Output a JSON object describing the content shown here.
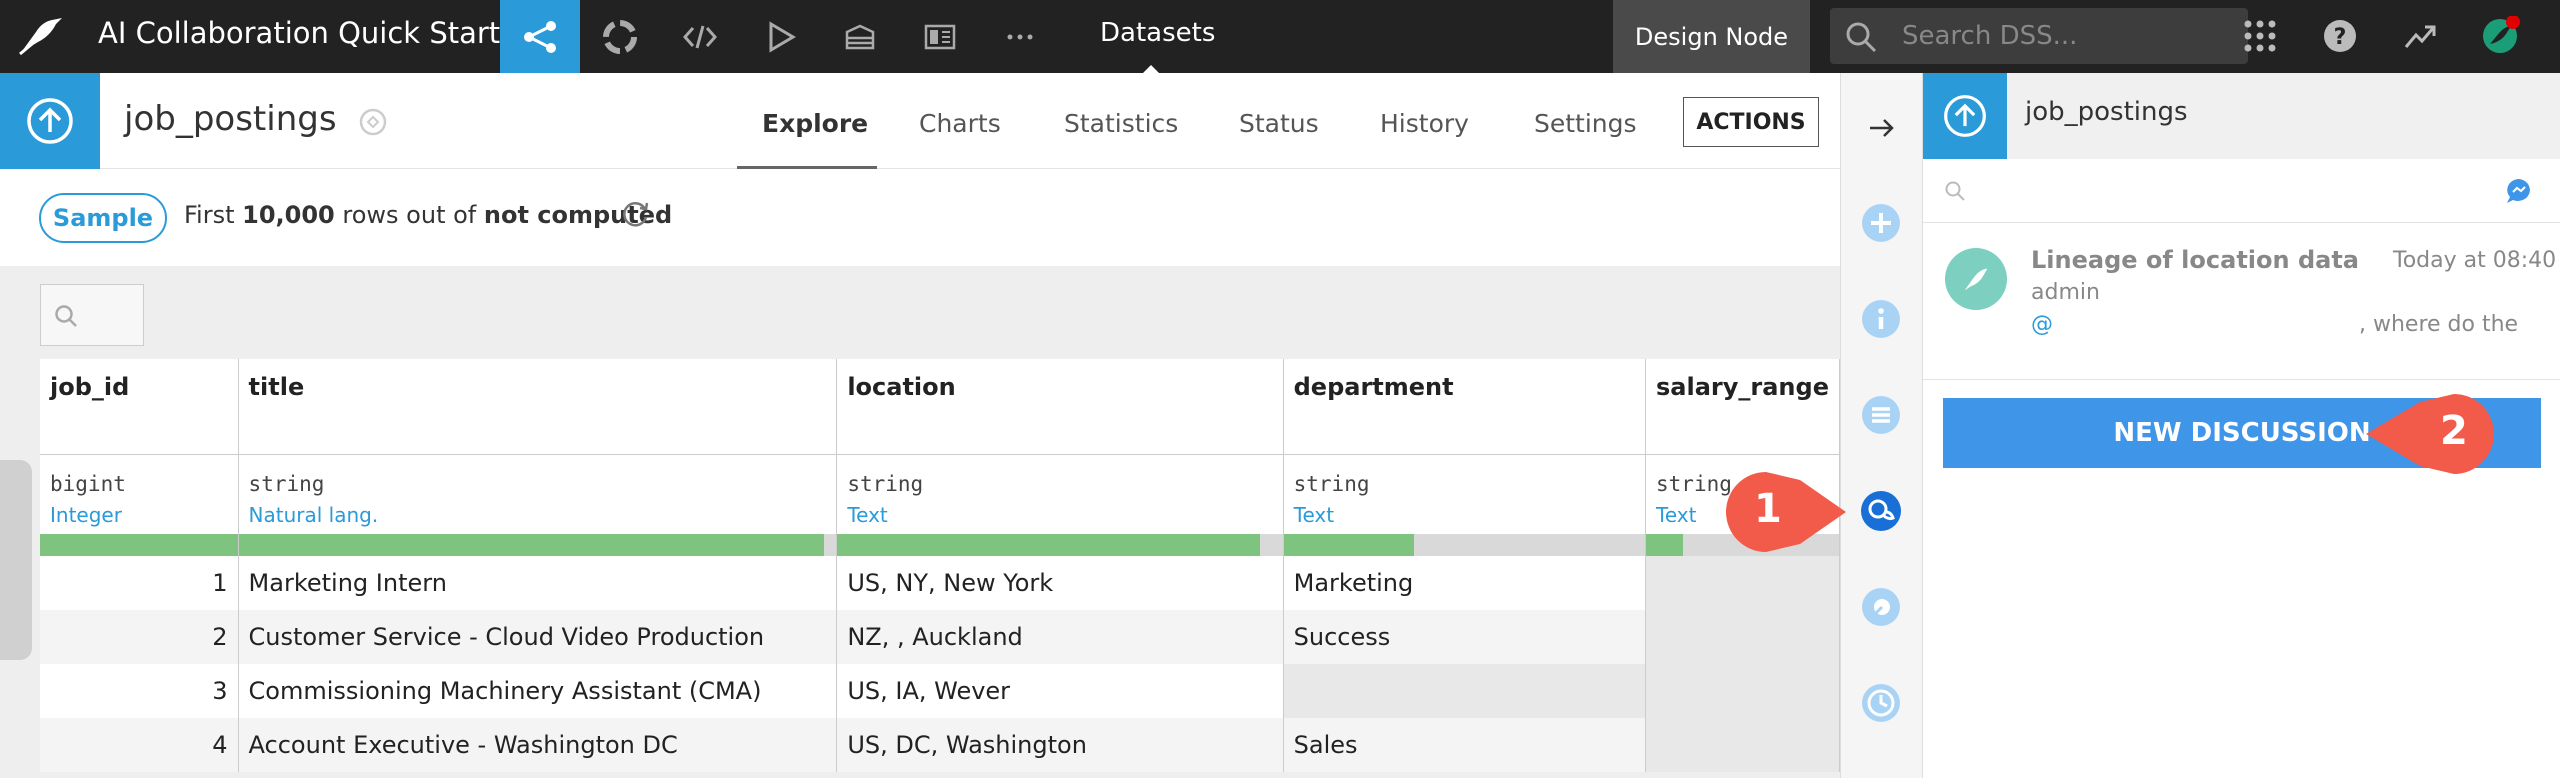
{
  "topbar": {
    "project_title": "AI Collaboration Quick Start",
    "section": "Datasets",
    "design_node": "Design Node",
    "search_placeholder": "Search DSS...",
    "colors": {
      "bar": "#222222",
      "accent": "#2a9bd8"
    },
    "nav_icons": [
      "flow-icon",
      "lab-icon",
      "code-icon",
      "run-icon",
      "stack-icon",
      "dashboard-icon",
      "more-icon"
    ]
  },
  "dataset": {
    "name": "job_postings",
    "tabs": [
      "Explore",
      "Charts",
      "Statistics",
      "Status",
      "History",
      "Settings"
    ],
    "active_tab": "Explore",
    "actions_label": "ACTIONS"
  },
  "sample": {
    "button": "Sample",
    "text_prefix": "First ",
    "rows": "10,000",
    "text_middle": " rows out of ",
    "total": "not computed"
  },
  "grid": {
    "columns": [
      {
        "name": "job_id",
        "type": "bigint",
        "meaning": "Integer",
        "valid": 1.0
      },
      {
        "name": "title",
        "type": "string",
        "meaning": "Natural lang.",
        "valid": 0.98
      },
      {
        "name": "location",
        "type": "string",
        "meaning": "Text",
        "valid": 0.95
      },
      {
        "name": "department",
        "type": "string",
        "meaning": "Text",
        "valid": 0.36
      },
      {
        "name": "salary_range",
        "type": "string",
        "meaning": "Text",
        "valid": 0.19
      }
    ],
    "rows": [
      {
        "job_id": "1",
        "title": "Marketing Intern",
        "location": "US, NY, New York",
        "department": "Marketing",
        "salary_range": ""
      },
      {
        "job_id": "2",
        "title": "Customer Service - Cloud Video Production",
        "location": "NZ, , Auckland",
        "department": "Success",
        "salary_range": ""
      },
      {
        "job_id": "3",
        "title": "Commissioning Machinery Assistant (CMA)",
        "location": "US, IA, Wever",
        "department": "",
        "salary_range": ""
      },
      {
        "job_id": "4",
        "title": "Account Executive - Washington DC",
        "location": "US, DC, Washington",
        "department": "Sales",
        "salary_range": ""
      }
    ]
  },
  "side_strip": {
    "icons": [
      "arrow-right-icon",
      "add-icon",
      "info-icon",
      "list-icon",
      "discussions-icon",
      "lab-icon",
      "history-icon"
    ],
    "active": "discussions-icon"
  },
  "right_panel": {
    "title": "job_postings",
    "discussion": {
      "title": "Lineage of location data",
      "time": "Today at 08:40",
      "author": "admin",
      "mention": "@",
      "snippet": ", where do the"
    },
    "new_button": "NEW DISCUSSION"
  },
  "callouts": [
    "1",
    "2"
  ]
}
